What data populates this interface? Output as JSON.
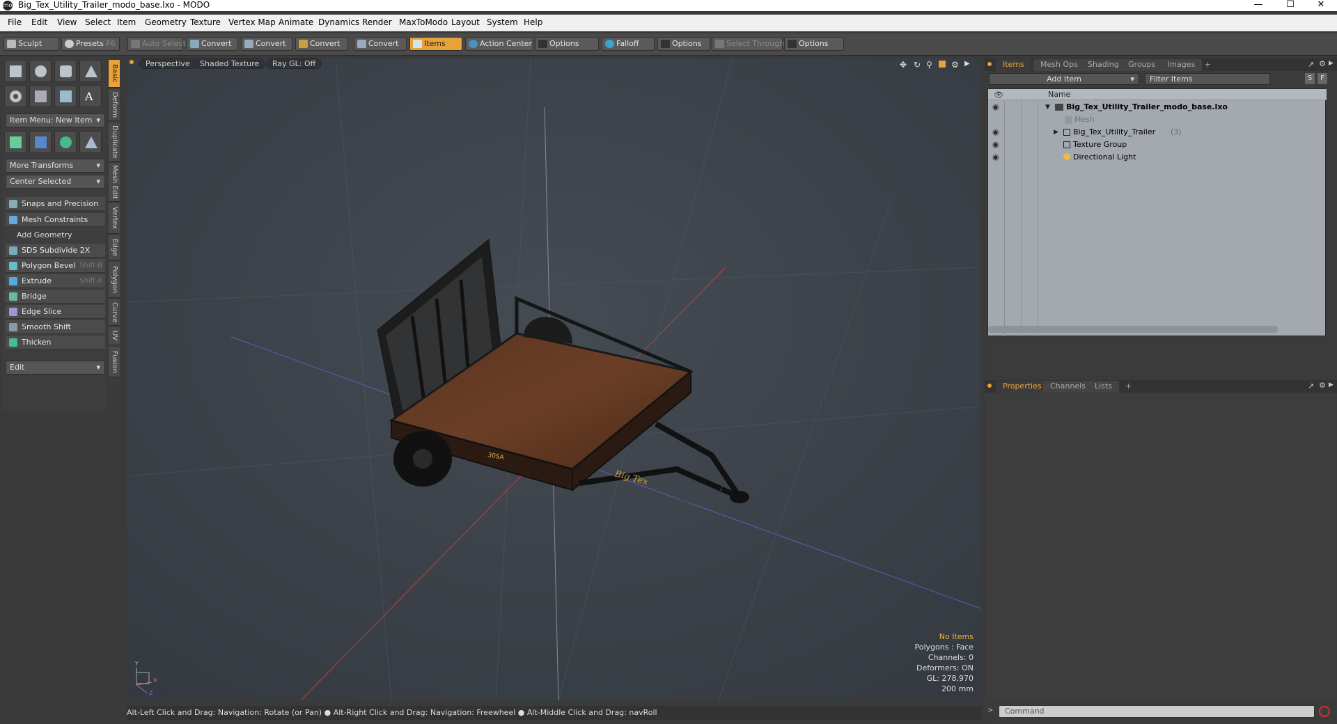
{
  "window": {
    "title": "Big_Tex_Utility_Trailer_modo_base.lxo - MODO",
    "logo": "mo"
  },
  "menu": [
    "File",
    "Edit",
    "View",
    "Select",
    "Item",
    "Geometry",
    "Texture",
    "Vertex Map",
    "Animate",
    "Dynamics",
    "Render",
    "MaxToModo",
    "Layout",
    "System",
    "Help"
  ],
  "toolbar": {
    "sculpt": "Sculpt",
    "presets": "Presets",
    "presets_key": "F6",
    "auto_select": "Auto Select",
    "convert": "Convert",
    "items": "Items",
    "action_center": "Action Center",
    "options": "Options",
    "falloff": "Falloff",
    "select_through": "Select Through"
  },
  "left": {
    "item_menu": "Item Menu: New Item",
    "more_transforms": "More Transforms",
    "center_selected": "Center Selected",
    "snaps": "Snaps and Precision",
    "mesh_constraints": "Mesh Constraints",
    "add_geometry": "Add Geometry",
    "tools": [
      {
        "label": "SDS Subdivide 2X",
        "key": ""
      },
      {
        "label": "Polygon Bevel",
        "key": "Shift-B"
      },
      {
        "label": "Extrude",
        "key": "Shift-X"
      },
      {
        "label": "Bridge",
        "key": ""
      },
      {
        "label": "Edge Slice",
        "key": ""
      },
      {
        "label": "Smooth Shift",
        "key": ""
      },
      {
        "label": "Thicken",
        "key": ""
      }
    ],
    "edit": "Edit"
  },
  "vtabs": [
    "Basic",
    "Deform",
    "Duplicate",
    "Mesh Edit",
    "Vertex",
    "Edge",
    "Polygon",
    "Curve",
    "UV",
    "Fusion"
  ],
  "viewport": {
    "perspective": "Perspective",
    "shading": "Shaded Texture",
    "raygl": "Ray GL: Off",
    "stats": {
      "selection": "No Items",
      "polygons": "Polygons : Face",
      "channels": "Channels: 0",
      "deformers": "Deformers: ON",
      "gl": "GL: 278,970",
      "scale": "200 mm"
    },
    "axis_labels": {
      "y": "Y",
      "x": "X",
      "z": "Z"
    },
    "trailer_decal": "Big Tex",
    "trailer_model": "30SA"
  },
  "status": "Alt-Left Click and Drag: Navigation: Rotate (or Pan) ● Alt-Right Click and Drag: Navigation: Freewheel ● Alt-Middle Click and Drag: navRoll",
  "items_panel": {
    "tabs": [
      "Items",
      "Mesh Ops",
      "Shading",
      "Groups",
      "Images",
      "+"
    ],
    "add_item": "Add Item",
    "filter": "Filter Items",
    "col_name": "Name",
    "s_btn": "S",
    "f_btn": "F",
    "rows": [
      {
        "name": "Big_Tex_Utility_Trailer_modo_base.lxo",
        "count": ""
      },
      {
        "name": "Mesh",
        "count": ""
      },
      {
        "name": "Big_Tex_Utility_Trailer",
        "count": "(3)"
      },
      {
        "name": "Texture Group",
        "count": ""
      },
      {
        "name": "Directional Light",
        "count": ""
      }
    ]
  },
  "props_panel": {
    "tabs": [
      "Properties",
      "Channels",
      "Lists",
      "+"
    ]
  },
  "command": {
    "placeholder": "Command"
  },
  "colors": {
    "accent": "#e8a23a",
    "viewport": "#3b4047",
    "items_bg": "#9aa0a6"
  }
}
